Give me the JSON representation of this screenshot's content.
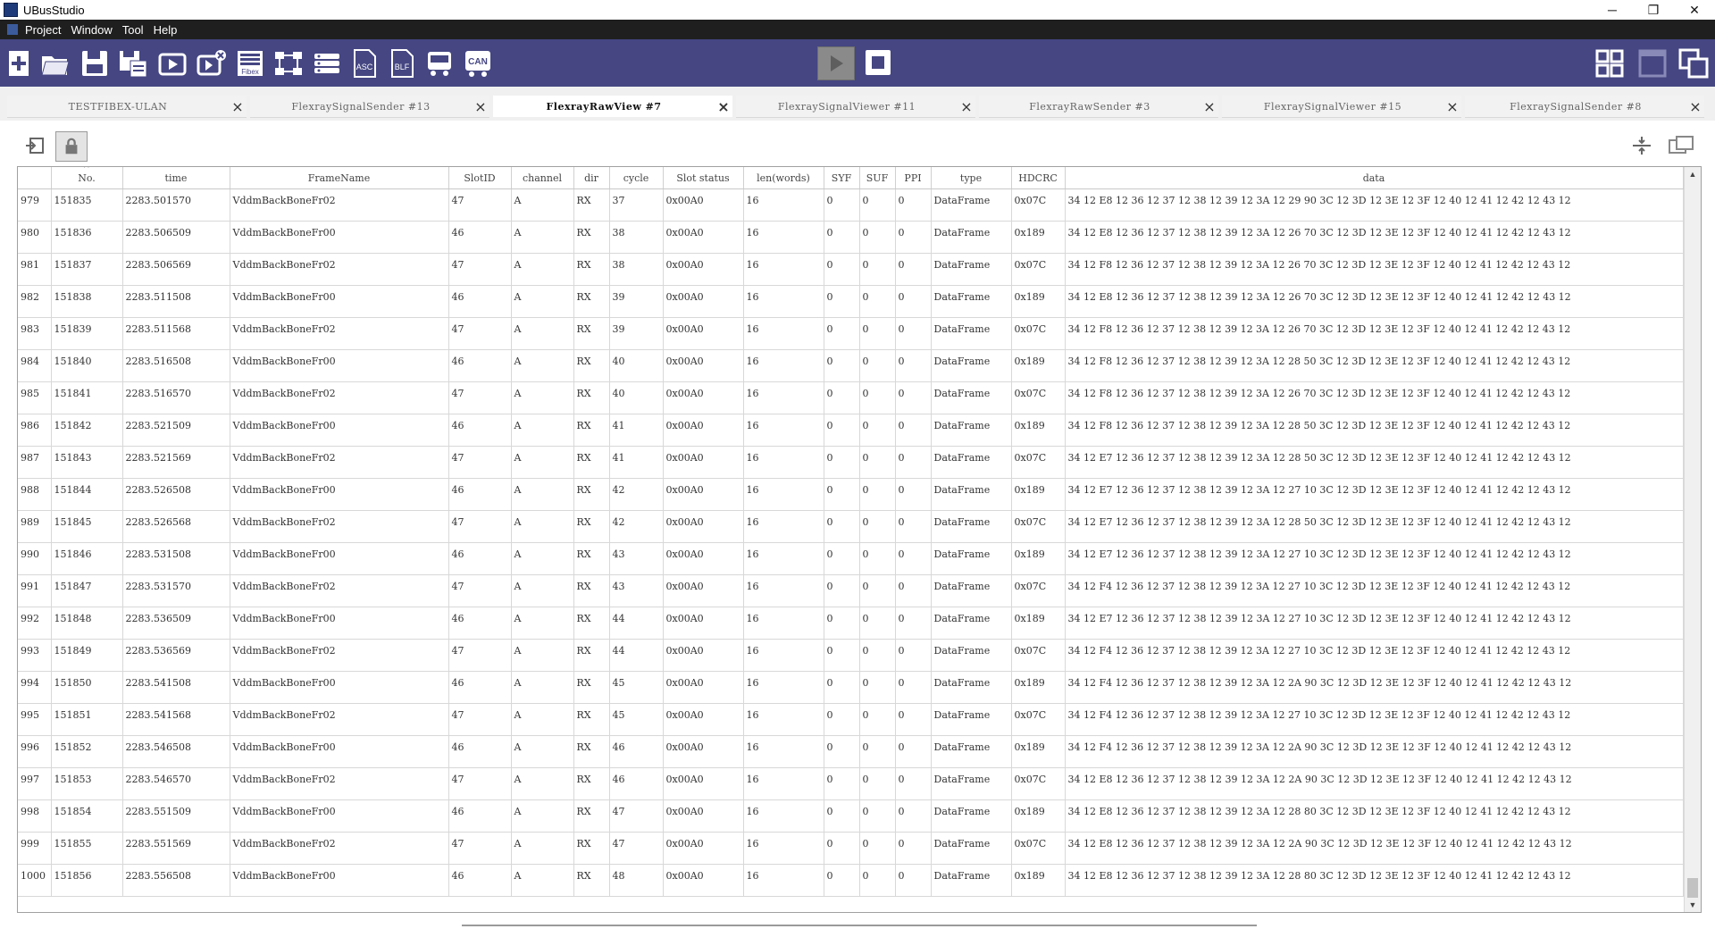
{
  "window": {
    "title": "UBusStudio",
    "min_glyph": "─",
    "max_glyph": "❐",
    "close_glyph": "✕"
  },
  "menu": [
    "Project",
    "Window",
    "Tool",
    "Help"
  ],
  "toolbar": {
    "icons": [
      "new-project-icon",
      "open-folder-icon",
      "save-icon",
      "save-as-icon",
      "run-config-icon",
      "stop-config-icon",
      "fibex-icon",
      "network-icon",
      "database-icon",
      "asc-icon",
      "blf-icon",
      "bus-signal-icon",
      "can-icon"
    ],
    "labels": {
      "fibex": "Fibex",
      "asc": "ASC",
      "blf": "BLF",
      "can": "CAN"
    },
    "layout_icons": [
      "tile-grid-icon",
      "single-window-icon",
      "cascade-windows-icon"
    ]
  },
  "tabs": [
    {
      "label": "TESTFIBEX-ULAN",
      "active": false
    },
    {
      "label": "FlexraySignalSender #13",
      "active": false
    },
    {
      "label": "FlexrayRawView #7",
      "active": true
    },
    {
      "label": "FlexraySignalViewer #11",
      "active": false
    },
    {
      "label": "FlexrayRawSender #3",
      "active": false
    },
    {
      "label": "FlexraySignalViewer #15",
      "active": false
    },
    {
      "label": "FlexraySignalSender #8",
      "active": false
    }
  ],
  "table": {
    "columns": [
      "",
      "No.",
      "time",
      "FrameName",
      "SlotID",
      "channel",
      "dir",
      "cycle",
      "Slot status",
      "len(words)",
      "SYF",
      "SUF",
      "PPI",
      "type",
      "HDCRC",
      "data"
    ],
    "rows": [
      [
        "979",
        "151835",
        "2283.501570",
        "VddmBackBoneFr02",
        "47",
        "A",
        "RX",
        "37",
        "0x00A0",
        "16",
        "0",
        "0",
        "0",
        "DataFrame",
        "0x07C",
        "34 12 E8 12 36 12 37 12 38 12 39 12 3A 12 29 90 3C 12 3D 12 3E 12 3F 12 40 12 41 12 42 12 43 12"
      ],
      [
        "980",
        "151836",
        "2283.506509",
        "VddmBackBoneFr00",
        "46",
        "A",
        "RX",
        "38",
        "0x00A0",
        "16",
        "0",
        "0",
        "0",
        "DataFrame",
        "0x189",
        "34 12 E8 12 36 12 37 12 38 12 39 12 3A 12 26 70 3C 12 3D 12 3E 12 3F 12 40 12 41 12 42 12 43 12"
      ],
      [
        "981",
        "151837",
        "2283.506569",
        "VddmBackBoneFr02",
        "47",
        "A",
        "RX",
        "38",
        "0x00A0",
        "16",
        "0",
        "0",
        "0",
        "DataFrame",
        "0x07C",
        "34 12 F8 12 36 12 37 12 38 12 39 12 3A 12 26 70 3C 12 3D 12 3E 12 3F 12 40 12 41 12 42 12 43 12"
      ],
      [
        "982",
        "151838",
        "2283.511508",
        "VddmBackBoneFr00",
        "46",
        "A",
        "RX",
        "39",
        "0x00A0",
        "16",
        "0",
        "0",
        "0",
        "DataFrame",
        "0x189",
        "34 12 E8 12 36 12 37 12 38 12 39 12 3A 12 26 70 3C 12 3D 12 3E 12 3F 12 40 12 41 12 42 12 43 12"
      ],
      [
        "983",
        "151839",
        "2283.511568",
        "VddmBackBoneFr02",
        "47",
        "A",
        "RX",
        "39",
        "0x00A0",
        "16",
        "0",
        "0",
        "0",
        "DataFrame",
        "0x07C",
        "34 12 F8 12 36 12 37 12 38 12 39 12 3A 12 26 70 3C 12 3D 12 3E 12 3F 12 40 12 41 12 42 12 43 12"
      ],
      [
        "984",
        "151840",
        "2283.516508",
        "VddmBackBoneFr00",
        "46",
        "A",
        "RX",
        "40",
        "0x00A0",
        "16",
        "0",
        "0",
        "0",
        "DataFrame",
        "0x189",
        "34 12 F8 12 36 12 37 12 38 12 39 12 3A 12 28 50 3C 12 3D 12 3E 12 3F 12 40 12 41 12 42 12 43 12"
      ],
      [
        "985",
        "151841",
        "2283.516570",
        "VddmBackBoneFr02",
        "47",
        "A",
        "RX",
        "40",
        "0x00A0",
        "16",
        "0",
        "0",
        "0",
        "DataFrame",
        "0x07C",
        "34 12 F8 12 36 12 37 12 38 12 39 12 3A 12 26 70 3C 12 3D 12 3E 12 3F 12 40 12 41 12 42 12 43 12"
      ],
      [
        "986",
        "151842",
        "2283.521509",
        "VddmBackBoneFr00",
        "46",
        "A",
        "RX",
        "41",
        "0x00A0",
        "16",
        "0",
        "0",
        "0",
        "DataFrame",
        "0x189",
        "34 12 F8 12 36 12 37 12 38 12 39 12 3A 12 28 50 3C 12 3D 12 3E 12 3F 12 40 12 41 12 42 12 43 12"
      ],
      [
        "987",
        "151843",
        "2283.521569",
        "VddmBackBoneFr02",
        "47",
        "A",
        "RX",
        "41",
        "0x00A0",
        "16",
        "0",
        "0",
        "0",
        "DataFrame",
        "0x07C",
        "34 12 E7 12 36 12 37 12 38 12 39 12 3A 12 28 50 3C 12 3D 12 3E 12 3F 12 40 12 41 12 42 12 43 12"
      ],
      [
        "988",
        "151844",
        "2283.526508",
        "VddmBackBoneFr00",
        "46",
        "A",
        "RX",
        "42",
        "0x00A0",
        "16",
        "0",
        "0",
        "0",
        "DataFrame",
        "0x189",
        "34 12 E7 12 36 12 37 12 38 12 39 12 3A 12 27 10 3C 12 3D 12 3E 12 3F 12 40 12 41 12 42 12 43 12"
      ],
      [
        "989",
        "151845",
        "2283.526568",
        "VddmBackBoneFr02",
        "47",
        "A",
        "RX",
        "42",
        "0x00A0",
        "16",
        "0",
        "0",
        "0",
        "DataFrame",
        "0x07C",
        "34 12 E7 12 36 12 37 12 38 12 39 12 3A 12 28 50 3C 12 3D 12 3E 12 3F 12 40 12 41 12 42 12 43 12"
      ],
      [
        "990",
        "151846",
        "2283.531508",
        "VddmBackBoneFr00",
        "46",
        "A",
        "RX",
        "43",
        "0x00A0",
        "16",
        "0",
        "0",
        "0",
        "DataFrame",
        "0x189",
        "34 12 E7 12 36 12 37 12 38 12 39 12 3A 12 27 10 3C 12 3D 12 3E 12 3F 12 40 12 41 12 42 12 43 12"
      ],
      [
        "991",
        "151847",
        "2283.531570",
        "VddmBackBoneFr02",
        "47",
        "A",
        "RX",
        "43",
        "0x00A0",
        "16",
        "0",
        "0",
        "0",
        "DataFrame",
        "0x07C",
        "34 12 F4 12 36 12 37 12 38 12 39 12 3A 12 27 10 3C 12 3D 12 3E 12 3F 12 40 12 41 12 42 12 43 12"
      ],
      [
        "992",
        "151848",
        "2283.536509",
        "VddmBackBoneFr00",
        "46",
        "A",
        "RX",
        "44",
        "0x00A0",
        "16",
        "0",
        "0",
        "0",
        "DataFrame",
        "0x189",
        "34 12 E7 12 36 12 37 12 38 12 39 12 3A 12 27 10 3C 12 3D 12 3E 12 3F 12 40 12 41 12 42 12 43 12"
      ],
      [
        "993",
        "151849",
        "2283.536569",
        "VddmBackBoneFr02",
        "47",
        "A",
        "RX",
        "44",
        "0x00A0",
        "16",
        "0",
        "0",
        "0",
        "DataFrame",
        "0x07C",
        "34 12 F4 12 36 12 37 12 38 12 39 12 3A 12 27 10 3C 12 3D 12 3E 12 3F 12 40 12 41 12 42 12 43 12"
      ],
      [
        "994",
        "151850",
        "2283.541508",
        "VddmBackBoneFr00",
        "46",
        "A",
        "RX",
        "45",
        "0x00A0",
        "16",
        "0",
        "0",
        "0",
        "DataFrame",
        "0x189",
        "34 12 F4 12 36 12 37 12 38 12 39 12 3A 12 2A 90 3C 12 3D 12 3E 12 3F 12 40 12 41 12 42 12 43 12"
      ],
      [
        "995",
        "151851",
        "2283.541568",
        "VddmBackBoneFr02",
        "47",
        "A",
        "RX",
        "45",
        "0x00A0",
        "16",
        "0",
        "0",
        "0",
        "DataFrame",
        "0x07C",
        "34 12 F4 12 36 12 37 12 38 12 39 12 3A 12 27 10 3C 12 3D 12 3E 12 3F 12 40 12 41 12 42 12 43 12"
      ],
      [
        "996",
        "151852",
        "2283.546508",
        "VddmBackBoneFr00",
        "46",
        "A",
        "RX",
        "46",
        "0x00A0",
        "16",
        "0",
        "0",
        "0",
        "DataFrame",
        "0x189",
        "34 12 F4 12 36 12 37 12 38 12 39 12 3A 12 2A 90 3C 12 3D 12 3E 12 3F 12 40 12 41 12 42 12 43 12"
      ],
      [
        "997",
        "151853",
        "2283.546570",
        "VddmBackBoneFr02",
        "47",
        "A",
        "RX",
        "46",
        "0x00A0",
        "16",
        "0",
        "0",
        "0",
        "DataFrame",
        "0x07C",
        "34 12 E8 12 36 12 37 12 38 12 39 12 3A 12 2A 90 3C 12 3D 12 3E 12 3F 12 40 12 41 12 42 12 43 12"
      ],
      [
        "998",
        "151854",
        "2283.551509",
        "VddmBackBoneFr00",
        "46",
        "A",
        "RX",
        "47",
        "0x00A0",
        "16",
        "0",
        "0",
        "0",
        "DataFrame",
        "0x189",
        "34 12 E8 12 36 12 37 12 38 12 39 12 3A 12 28 80 3C 12 3D 12 3E 12 3F 12 40 12 41 12 42 12 43 12"
      ],
      [
        "999",
        "151855",
        "2283.551569",
        "VddmBackBoneFr02",
        "47",
        "A",
        "RX",
        "47",
        "0x00A0",
        "16",
        "0",
        "0",
        "0",
        "DataFrame",
        "0x07C",
        "34 12 E8 12 36 12 37 12 38 12 39 12 3A 12 2A 90 3C 12 3D 12 3E 12 3F 12 40 12 41 12 42 12 43 12"
      ],
      [
        "1000",
        "151856",
        "2283.556508",
        "VddmBackBoneFr00",
        "46",
        "A",
        "RX",
        "48",
        "0x00A0",
        "16",
        "0",
        "0",
        "0",
        "DataFrame",
        "0x189",
        "34 12 E8 12 36 12 37 12 38 12 39 12 3A 12 28 80 3C 12 3D 12 3E 12 3F 12 40 12 41 12 42 12 43 12"
      ]
    ]
  },
  "colors": {
    "toolbar_bg": "#454682",
    "menubar_bg": "#1f1f1f"
  }
}
